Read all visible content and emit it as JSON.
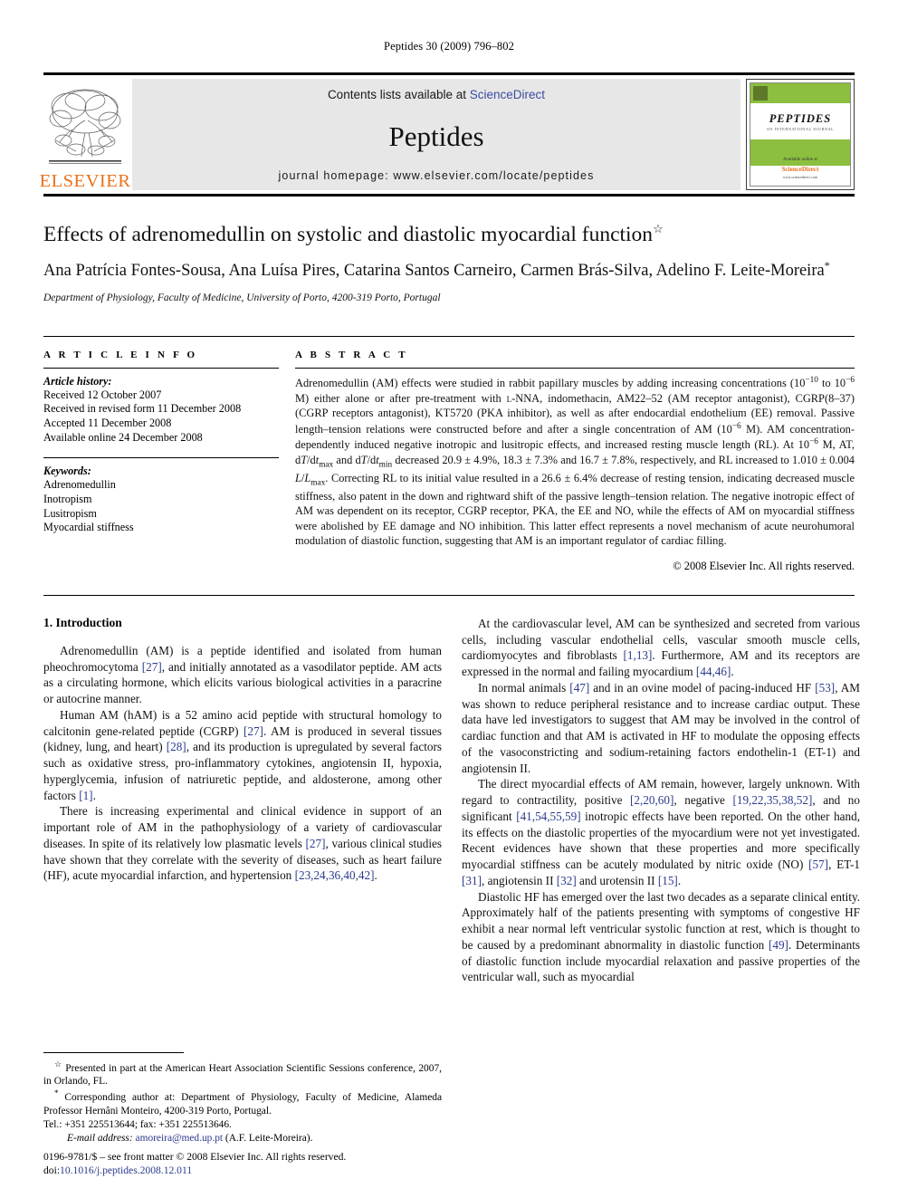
{
  "running_head": "Peptides 30 (2009) 796–802",
  "masthead": {
    "publisher_name": "ELSEVIER",
    "contents_prefix": "Contents lists available at ",
    "sciencedirect": "ScienceDirect",
    "journal_title": "Peptides",
    "homepage": "journal homepage: www.elsevier.com/locate/peptides",
    "cover": {
      "title": "PEPTIDES",
      "subtitle": "AN INTERNATIONAL JOURNAL",
      "available_at": "Available online at",
      "platform": "ScienceDirect",
      "platform_url": "www.sciencedirect.com"
    },
    "accent_orange": "#E9711C",
    "accent_green": "#8cbf3f",
    "link_blue": "#3b4da0"
  },
  "article": {
    "title": "Effects of adrenomedullin on systolic and diastolic myocardial function",
    "title_footnote_mark": "☆",
    "authors": "Ana Patrícia Fontes-Sousa, Ana Luísa Pires, Catarina Santos Carneiro, Carmen Brás-Silva, Adelino F. Leite-Moreira",
    "corresponding_mark": "*",
    "affiliation": "Department of Physiology, Faculty of Medicine, University of Porto, 4200-319 Porto, Portugal"
  },
  "article_info": {
    "heading": "A R T I C L E   I N F O",
    "history_label": "Article history:",
    "history": [
      "Received 12 October 2007",
      "Received in revised form 11 December 2008",
      "Accepted 11 December 2008",
      "Available online 24 December 2008"
    ],
    "keywords_label": "Keywords:",
    "keywords": [
      "Adrenomedullin",
      "Inotropism",
      "Lusitropism",
      "Myocardial stiffness"
    ]
  },
  "abstract": {
    "heading": "A B S T R A C T",
    "copyright": "© 2008 Elsevier Inc. All rights reserved."
  },
  "introduction": {
    "heading": "1. Introduction",
    "left_paragraphs": [
      "Adrenomedullin (AM) is a peptide identified and isolated from human pheochromocytoma [27], and initially annotated as a vasodilator peptide. AM acts as a circulating hormone, which elicits various biological activities in a paracrine or autocrine manner.",
      "Human AM (hAM) is a 52 amino acid peptide with structural homology to calcitonin gene-related peptide (CGRP) [27]. AM is produced in several tissues (kidney, lung, and heart) [28], and its production is upregulated by several factors such as oxidative stress, pro-inflammatory cytokines, angiotensin II, hypoxia, hyperglycemia, infusion of natriuretic peptide, and aldosterone, among other factors [1].",
      "There is increasing experimental and clinical evidence in support of an important role of AM in the pathophysiology of a variety of cardiovascular diseases. In spite of its relatively low plasmatic levels [27], various clinical studies have shown that they correlate with the severity of diseases, such as heart failure (HF), acute myocardial infarction, and hypertension [23,24,36,40,42]."
    ]
  },
  "footnotes": {
    "presented": "Presented in part at the American Heart Association Scientific Sessions conference, 2007, in Orlando, FL.",
    "corresponding": "Corresponding author at: Department of Physiology, Faculty of Medicine, Alameda Professor Hernâni Monteiro, 4200-319 Porto, Portugal.",
    "telephone": "Tel.: +351 225513644; fax: +351 225513646.",
    "email_label": "E-mail address:",
    "email": "amoreira@med.up.pt",
    "email_owner": "(A.F. Leite-Moreira).",
    "issn_line": "0196-9781/$ – see front matter © 2008 Elsevier Inc. All rights reserved.",
    "doi_label": "doi:",
    "doi": "10.1016/j.peptides.2008.12.011"
  }
}
